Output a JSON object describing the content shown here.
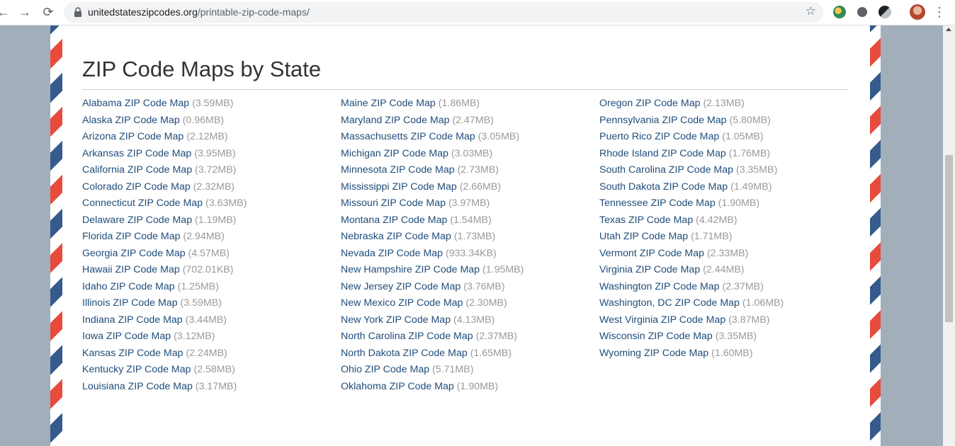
{
  "browser": {
    "back_glyph": "←",
    "forward_glyph": "→",
    "reload_glyph": "⟳",
    "url_domain": "unitedstateszipcodes.org",
    "url_path": "/printable-zip-code-maps/",
    "bookmark_glyph": "☆",
    "menu_glyph": "⋮",
    "icons": [
      "back-icon",
      "forward-icon",
      "reload-icon",
      "lock-icon",
      "star-icon",
      "extension-icon",
      "profile-avatar",
      "kebab-menu-icon"
    ]
  },
  "page": {
    "title": "ZIP Code Maps by State",
    "columns": [
      [
        {
          "label": "Alabama ZIP Code Map",
          "size": "(3.59MB)"
        },
        {
          "label": "Alaska ZIP Code Map",
          "size": "(0.96MB)"
        },
        {
          "label": "Arizona ZIP Code Map",
          "size": "(2.12MB)"
        },
        {
          "label": "Arkansas ZIP Code Map",
          "size": "(3.95MB)"
        },
        {
          "label": "California ZIP Code Map",
          "size": "(3.72MB)"
        },
        {
          "label": "Colorado ZIP Code Map",
          "size": "(2.32MB)"
        },
        {
          "label": "Connecticut ZIP Code Map",
          "size": "(3.63MB)"
        },
        {
          "label": "Delaware ZIP Code Map",
          "size": "(1.19MB)"
        },
        {
          "label": "Florida ZIP Code Map",
          "size": "(2.94MB)"
        },
        {
          "label": "Georgia ZIP Code Map",
          "size": "(4.57MB)"
        },
        {
          "label": "Hawaii ZIP Code Map",
          "size": "(702.01KB)"
        },
        {
          "label": "Idaho ZIP Code Map",
          "size": "(1.25MB)"
        },
        {
          "label": "Illinois ZIP Code Map",
          "size": "(3.59MB)"
        },
        {
          "label": "Indiana ZIP Code Map",
          "size": "(3.44MB)"
        },
        {
          "label": "Iowa ZIP Code Map",
          "size": "(3.12MB)"
        },
        {
          "label": "Kansas ZIP Code Map",
          "size": "(2.24MB)"
        },
        {
          "label": "Kentucky ZIP Code Map",
          "size": "(2.58MB)"
        },
        {
          "label": "Louisiana ZIP Code Map",
          "size": "(3.17MB)"
        }
      ],
      [
        {
          "label": "Maine ZIP Code Map",
          "size": "(1.86MB)"
        },
        {
          "label": "Maryland ZIP Code Map",
          "size": "(2.47MB)"
        },
        {
          "label": "Massachusetts ZIP Code Map",
          "size": "(3.05MB)"
        },
        {
          "label": "Michigan ZIP Code Map",
          "size": "(3.03MB)"
        },
        {
          "label": "Minnesota ZIP Code Map",
          "size": "(2.73MB)"
        },
        {
          "label": "Mississippi ZIP Code Map",
          "size": "(2.66MB)"
        },
        {
          "label": "Missouri ZIP Code Map",
          "size": "(3.97MB)"
        },
        {
          "label": "Montana ZIP Code Map",
          "size": "(1.54MB)"
        },
        {
          "label": "Nebraska ZIP Code Map",
          "size": "(1.73MB)"
        },
        {
          "label": "Nevada ZIP Code Map",
          "size": "(933.34KB)"
        },
        {
          "label": "New Hampshire ZIP Code Map",
          "size": "(1.95MB)"
        },
        {
          "label": "New Jersey ZIP Code Map",
          "size": "(3.76MB)"
        },
        {
          "label": "New Mexico ZIP Code Map",
          "size": "(2.30MB)"
        },
        {
          "label": "New York ZIP Code Map",
          "size": "(4.13MB)"
        },
        {
          "label": "North Carolina ZIP Code Map",
          "size": "(2.37MB)"
        },
        {
          "label": "North Dakota ZIP Code Map",
          "size": "(1.65MB)"
        },
        {
          "label": "Ohio ZIP Code Map",
          "size": "(5.71MB)"
        },
        {
          "label": "Oklahoma ZIP Code Map",
          "size": "(1.90MB)"
        }
      ],
      [
        {
          "label": "Oregon ZIP Code Map",
          "size": "(2.13MB)"
        },
        {
          "label": "Pennsylvania ZIP Code Map",
          "size": "(5.80MB)"
        },
        {
          "label": "Puerto Rico ZIP Code Map",
          "size": "(1.05MB)"
        },
        {
          "label": "Rhode Island ZIP Code Map",
          "size": "(1.76MB)"
        },
        {
          "label": "South Carolina ZIP Code Map",
          "size": "(3.35MB)"
        },
        {
          "label": "South Dakota ZIP Code Map",
          "size": "(1.49MB)"
        },
        {
          "label": "Tennessee ZIP Code Map",
          "size": "(1.90MB)"
        },
        {
          "label": "Texas ZIP Code Map",
          "size": "(4.42MB)"
        },
        {
          "label": "Utah ZIP Code Map",
          "size": "(1.71MB)"
        },
        {
          "label": "Vermont ZIP Code Map",
          "size": "(2.33MB)"
        },
        {
          "label": "Virginia ZIP Code Map",
          "size": "(2.44MB)"
        },
        {
          "label": "Washington ZIP Code Map",
          "size": "(2.37MB)"
        },
        {
          "label": "Washington, DC ZIP Code Map",
          "size": "(1.06MB)"
        },
        {
          "label": "West Virginia ZIP Code Map",
          "size": "(3.87MB)"
        },
        {
          "label": "Wisconsin ZIP Code Map",
          "size": "(3.35MB)"
        },
        {
          "label": "Wyoming ZIP Code Map",
          "size": "(1.60MB)"
        }
      ]
    ]
  },
  "colors": {
    "link": "#1f4d7a",
    "size_text": "#999999",
    "airmail_red": "#e84b3c",
    "airmail_blue": "#345b8c",
    "page_bg": "#a3aebb"
  }
}
